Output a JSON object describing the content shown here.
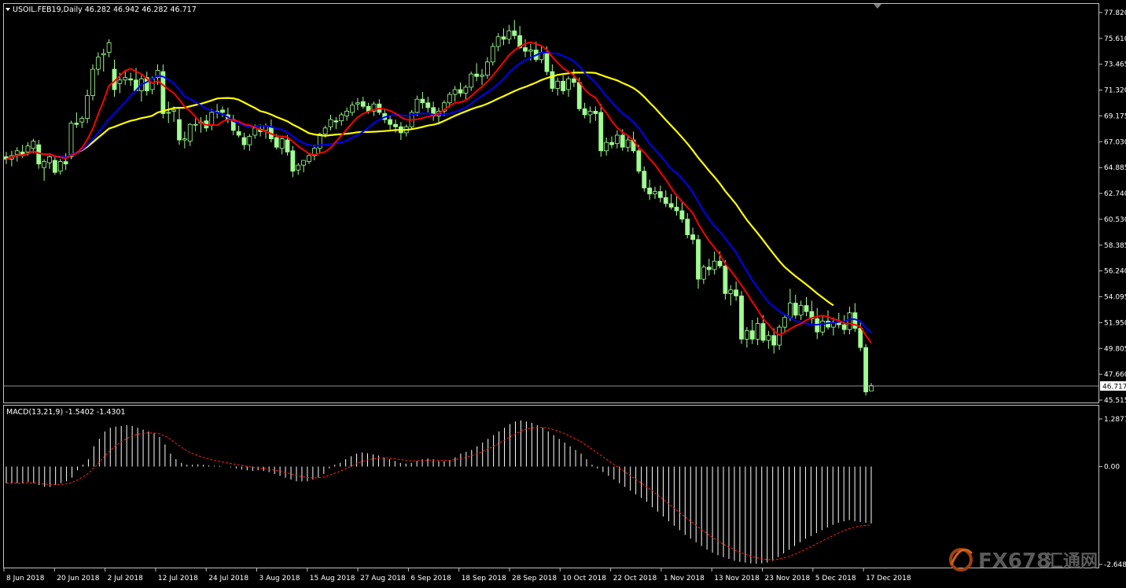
{
  "header": {
    "symbol_line": "USOIL.FEB19,Daily  46.282 46.942 46.282 46.717",
    "macd_line": "MACD(13,21,9) -1.5402 -1.4301",
    "current_price": "46.717"
  },
  "price_axis_labels": [
    "77.820",
    "75.610",
    "73.465",
    "71.320",
    "69.175",
    "67.030",
    "64.885",
    "62.740",
    "60.530",
    "58.385",
    "56.240",
    "54.095",
    "51.950",
    "49.805",
    "47.660",
    "45.515"
  ],
  "macd_axis_labels": [
    "1.2877",
    "0.00",
    "-2.6483"
  ],
  "date_labels": [
    "8 Jun 2018",
    "20 Jun 2018",
    "2 Jul 2018",
    "12 Jul 2018",
    "24 Jul 2018",
    "3 Aug 2018",
    "15 Aug 2018",
    "27 Aug 2018",
    "6 Sep 2018",
    "18 Sep 2018",
    "28 Sep 2018",
    "10 Oct 2018",
    "22 Oct 2018",
    "1 Nov 2018",
    "13 Nov 2018",
    "23 Nov 2018",
    "5 Dec 2018",
    "17 Dec 2018"
  ],
  "watermark": {
    "brand": "FX678",
    "cn": "汇通网"
  },
  "colors": {
    "ma_fast": "#ff0000",
    "ma_mid": "#0000ff",
    "ma_slow": "#ffff00",
    "candle": "#a0ff90",
    "macd_hist": "#ffffff",
    "macd_signal": "#ff2020"
  },
  "chart_data": {
    "type": "candlestick",
    "ylim": [
      45.515,
      77.82
    ],
    "macd_ylim": [
      -2.6483,
      1.2877
    ],
    "candles": [
      [
        65.8,
        66.2,
        65.2,
        65.6
      ],
      [
        65.6,
        66.3,
        65.0,
        65.9
      ],
      [
        66.0,
        66.6,
        65.4,
        66.3
      ],
      [
        66.2,
        66.8,
        65.7,
        65.9
      ],
      [
        66.2,
        67.0,
        65.9,
        66.7
      ],
      [
        66.5,
        67.3,
        66.1,
        67.1
      ],
      [
        66.8,
        67.2,
        64.8,
        65.2
      ],
      [
        64.9,
        65.6,
        63.8,
        65.4
      ],
      [
        65.3,
        66.0,
        64.8,
        65.8
      ],
      [
        65.5,
        65.8,
        64.3,
        64.5
      ],
      [
        64.6,
        65.6,
        64.3,
        65.4
      ],
      [
        65.4,
        66.1,
        64.7,
        65.2
      ],
      [
        65.8,
        68.8,
        65.6,
        68.6
      ],
      [
        68.6,
        69.5,
        68.2,
        68.5
      ],
      [
        68.7,
        69.2,
        68.2,
        69.0
      ],
      [
        69.0,
        71.4,
        68.6,
        70.9
      ],
      [
        70.9,
        73.5,
        70.5,
        73.1
      ],
      [
        73.1,
        74.5,
        72.6,
        74.1
      ],
      [
        74.3,
        74.8,
        72.9,
        74.4
      ],
      [
        74.5,
        75.6,
        74.1,
        75.3
      ],
      [
        73.1,
        73.9,
        70.8,
        71.4
      ],
      [
        71.9,
        72.8,
        71.1,
        72.2
      ],
      [
        72.2,
        72.9,
        71.8,
        72.4
      ],
      [
        72.3,
        72.8,
        71.7,
        72.2
      ],
      [
        72.2,
        73.2,
        71.5,
        71.3
      ],
      [
        71.3,
        72.6,
        70.4,
        72.3
      ],
      [
        72.4,
        72.9,
        70.9,
        71.3
      ],
      [
        71.4,
        72.5,
        71.0,
        72.3
      ],
      [
        72.4,
        73.5,
        71.8,
        73.0
      ],
      [
        72.9,
        73.5,
        69.0,
        69.4
      ],
      [
        69.5,
        70.4,
        68.6,
        69.5
      ],
      [
        69.6,
        70.0,
        68.7,
        69.7
      ],
      [
        68.9,
        69.8,
        66.8,
        67.2
      ],
      [
        67.2,
        67.9,
        66.5,
        67.3
      ],
      [
        67.1,
        68.6,
        66.7,
        68.5
      ],
      [
        68.5,
        69.0,
        67.9,
        68.5
      ],
      [
        68.6,
        69.1,
        67.8,
        68.7
      ],
      [
        68.8,
        69.3,
        67.9,
        68.2
      ],
      [
        68.4,
        69.8,
        68.0,
        69.5
      ],
      [
        69.5,
        70.2,
        69.0,
        69.6
      ],
      [
        69.7,
        70.0,
        69.1,
        69.5
      ],
      [
        69.3,
        69.9,
        68.6,
        68.9
      ],
      [
        68.9,
        69.3,
        67.6,
        68.0
      ],
      [
        67.9,
        68.4,
        67.4,
        67.6
      ],
      [
        67.4,
        67.8,
        66.4,
        66.8
      ],
      [
        66.8,
        67.7,
        66.3,
        67.5
      ],
      [
        67.6,
        68.5,
        67.3,
        68.2
      ],
      [
        68.1,
        68.5,
        67.5,
        67.9
      ],
      [
        68.0,
        68.6,
        67.3,
        68.4
      ],
      [
        68.3,
        68.9,
        67.0,
        67.3
      ],
      [
        67.4,
        67.7,
        66.4,
        66.6
      ],
      [
        66.5,
        67.5,
        66.0,
        67.3
      ],
      [
        67.2,
        67.6,
        65.9,
        66.2
      ],
      [
        66.3,
        66.7,
        64.1,
        64.6
      ],
      [
        64.7,
        65.3,
        64.3,
        65.1
      ],
      [
        65.1,
        65.5,
        64.5,
        65.5
      ],
      [
        65.4,
        66.1,
        65.2,
        65.9
      ],
      [
        65.9,
        66.8,
        65.5,
        66.5
      ],
      [
        66.5,
        67.8,
        66.1,
        67.7
      ],
      [
        67.7,
        68.4,
        67.4,
        68.2
      ],
      [
        68.3,
        69.3,
        68.0,
        68.9
      ],
      [
        68.8,
        69.1,
        68.1,
        68.7
      ],
      [
        68.8,
        69.5,
        68.4,
        69.3
      ],
      [
        69.2,
        69.9,
        68.8,
        69.6
      ],
      [
        69.5,
        70.4,
        69.2,
        70.1
      ],
      [
        70.2,
        70.7,
        69.7,
        70.3
      ],
      [
        70.4,
        70.8,
        69.8,
        70.0
      ],
      [
        70.0,
        70.3,
        69.4,
        69.6
      ],
      [
        69.6,
        70.4,
        69.2,
        70.2
      ],
      [
        70.2,
        70.6,
        69.3,
        69.5
      ],
      [
        69.4,
        69.8,
        68.6,
        68.9
      ],
      [
        68.9,
        69.3,
        68.0,
        68.5
      ],
      [
        68.5,
        68.9,
        67.8,
        68.3
      ],
      [
        68.3,
        68.7,
        67.2,
        67.8
      ],
      [
        67.8,
        68.5,
        67.5,
        68.3
      ],
      [
        68.3,
        69.7,
        68.1,
        69.5
      ],
      [
        69.5,
        70.9,
        69.2,
        70.6
      ],
      [
        70.6,
        71.2,
        69.8,
        70.3
      ],
      [
        70.3,
        70.8,
        69.5,
        69.9
      ],
      [
        69.9,
        70.4,
        68.8,
        69.2
      ],
      [
        69.2,
        69.9,
        68.5,
        69.6
      ],
      [
        69.6,
        70.5,
        69.2,
        70.3
      ],
      [
        70.3,
        71.2,
        69.9,
        71.0
      ],
      [
        71.0,
        71.7,
        70.4,
        71.4
      ],
      [
        71.4,
        72.0,
        70.8,
        71.1
      ],
      [
        71.1,
        71.8,
        70.6,
        71.6
      ],
      [
        71.6,
        72.9,
        71.3,
        72.7
      ],
      [
        72.7,
        73.6,
        72.1,
        72.5
      ],
      [
        72.5,
        73.1,
        71.8,
        72.6
      ],
      [
        72.6,
        74.1,
        72.3,
        73.7
      ],
      [
        73.7,
        75.3,
        73.4,
        75.0
      ],
      [
        75.0,
        76.1,
        74.6,
        75.8
      ],
      [
        75.8,
        76.5,
        75.1,
        75.6
      ],
      [
        75.6,
        76.8,
        75.2,
        76.3
      ],
      [
        76.3,
        77.2,
        75.6,
        75.9
      ],
      [
        75.9,
        76.7,
        74.8,
        74.9
      ],
      [
        74.9,
        75.6,
        74.1,
        74.6
      ],
      [
        74.6,
        75.2,
        73.8,
        74.7
      ],
      [
        74.7,
        75.4,
        73.7,
        73.9
      ],
      [
        73.9,
        75.0,
        73.6,
        74.5
      ],
      [
        74.5,
        75.0,
        72.6,
        72.9
      ],
      [
        72.9,
        73.5,
        71.2,
        71.5
      ],
      [
        71.5,
        72.4,
        70.9,
        72.1
      ],
      [
        72.1,
        72.6,
        71.0,
        71.3
      ],
      [
        71.4,
        72.5,
        70.8,
        72.3
      ],
      [
        72.3,
        73.1,
        71.6,
        72.0
      ],
      [
        72.0,
        72.4,
        69.6,
        69.8
      ],
      [
        69.8,
        70.3,
        69.0,
        69.3
      ],
      [
        69.3,
        70.0,
        68.6,
        69.6
      ],
      [
        69.6,
        70.0,
        68.8,
        69.4
      ],
      [
        69.5,
        70.2,
        65.8,
        66.3
      ],
      [
        66.3,
        67.4,
        65.9,
        67.0
      ],
      [
        67.0,
        67.5,
        66.5,
        66.8
      ],
      [
        66.9,
        68.0,
        66.5,
        67.6
      ],
      [
        67.6,
        68.1,
        66.3,
        66.6
      ],
      [
        66.6,
        67.6,
        66.2,
        67.2
      ],
      [
        67.2,
        67.9,
        66.1,
        66.3
      ],
      [
        66.3,
        66.8,
        64.4,
        64.6
      ],
      [
        64.6,
        65.0,
        62.9,
        63.2
      ],
      [
        63.2,
        63.9,
        62.2,
        62.7
      ],
      [
        62.7,
        63.3,
        62.3,
        62.9
      ],
      [
        62.9,
        63.4,
        62.0,
        62.4
      ],
      [
        62.4,
        63.0,
        61.6,
        61.9
      ],
      [
        61.9,
        62.7,
        61.4,
        61.6
      ],
      [
        61.6,
        62.5,
        60.9,
        61.3
      ],
      [
        61.3,
        62.0,
        60.3,
        60.6
      ],
      [
        60.6,
        61.1,
        59.0,
        59.3
      ],
      [
        59.3,
        59.9,
        58.5,
        58.9
      ],
      [
        58.9,
        59.3,
        54.8,
        55.6
      ],
      [
        55.6,
        56.8,
        55.2,
        56.6
      ],
      [
        56.6,
        57.3,
        55.9,
        56.4
      ],
      [
        56.4,
        57.9,
        56.0,
        57.1
      ],
      [
        57.1,
        57.9,
        56.5,
        56.7
      ],
      [
        56.7,
        57.2,
        53.9,
        54.4
      ],
      [
        54.4,
        55.1,
        53.4,
        54.7
      ],
      [
        54.7,
        55.4,
        53.8,
        54.2
      ],
      [
        54.2,
        54.6,
        50.2,
        50.6
      ],
      [
        50.6,
        51.6,
        49.9,
        51.3
      ],
      [
        51.3,
        52.2,
        50.2,
        50.6
      ],
      [
        50.6,
        52.4,
        50.1,
        51.9
      ],
      [
        51.9,
        52.6,
        50.3,
        50.5
      ],
      [
        50.5,
        51.3,
        49.8,
        50.9
      ],
      [
        50.9,
        51.5,
        49.4,
        50.1
      ],
      [
        50.1,
        51.8,
        49.7,
        51.6
      ],
      [
        51.6,
        52.7,
        51.1,
        52.4
      ],
      [
        52.4,
        54.8,
        52.1,
        53.6
      ],
      [
        53.6,
        54.3,
        52.3,
        52.6
      ],
      [
        52.6,
        53.8,
        52.2,
        53.4
      ],
      [
        53.4,
        54.1,
        52.5,
        52.9
      ],
      [
        52.9,
        53.8,
        51.9,
        52.3
      ],
      [
        52.3,
        53.2,
        50.6,
        51.2
      ],
      [
        51.2,
        52.5,
        50.9,
        52.1
      ],
      [
        52.1,
        53.0,
        51.4,
        51.6
      ],
      [
        51.6,
        52.4,
        50.9,
        52.0
      ],
      [
        52.0,
        52.8,
        51.5,
        51.8
      ],
      [
        51.8,
        52.6,
        51.0,
        51.4
      ],
      [
        51.4,
        53.3,
        51.0,
        52.8
      ],
      [
        52.8,
        53.6,
        51.2,
        51.5
      ],
      [
        51.5,
        52.0,
        49.6,
        49.9
      ],
      [
        49.9,
        50.2,
        45.9,
        46.2
      ],
      [
        46.282,
        46.942,
        46.282,
        46.717
      ]
    ],
    "macd_hist": [
      -0.45,
      -0.45,
      -0.45,
      -0.45,
      -0.42,
      -0.45,
      -0.5,
      -0.55,
      -0.55,
      -0.5,
      -0.45,
      -0.4,
      -0.3,
      -0.1,
      0.05,
      0.2,
      0.55,
      0.75,
      0.95,
      1.05,
      1.08,
      1.1,
      1.12,
      1.1,
      1.05,
      1.0,
      0.95,
      0.9,
      0.8,
      0.6,
      0.35,
      0.2,
      0.1,
      0.05,
      0.05,
      0.06,
      0.05,
      0.03,
      0.02,
      0.02,
      0.0,
      -0.02,
      -0.05,
      -0.08,
      -0.1,
      -0.12,
      -0.1,
      -0.12,
      -0.15,
      -0.2,
      -0.25,
      -0.3,
      -0.35,
      -0.4,
      -0.4,
      -0.4,
      -0.35,
      -0.3,
      -0.2,
      -0.05,
      0.05,
      0.1,
      0.2,
      0.28,
      0.35,
      0.38,
      0.36,
      0.33,
      0.3,
      0.25,
      0.2,
      0.15,
      0.1,
      0.08,
      0.1,
      0.15,
      0.2,
      0.22,
      0.2,
      0.15,
      0.15,
      0.18,
      0.25,
      0.35,
      0.4,
      0.45,
      0.55,
      0.65,
      0.75,
      0.85,
      0.95,
      1.05,
      1.15,
      1.22,
      1.25,
      1.22,
      1.18,
      1.12,
      1.05,
      0.95,
      0.85,
      0.75,
      0.65,
      0.55,
      0.45,
      0.35,
      0.2,
      0.05,
      -0.05,
      -0.15,
      -0.25,
      -0.35,
      -0.45,
      -0.55,
      -0.65,
      -0.75,
      -0.85,
      -0.95,
      -1.1,
      -1.22,
      -1.35,
      -1.48,
      -1.6,
      -1.72,
      -1.85,
      -1.95,
      -2.05,
      -2.15,
      -2.25,
      -2.33,
      -2.4,
      -2.45,
      -2.5,
      -2.55,
      -2.58,
      -2.6,
      -2.62,
      -2.63,
      -2.62,
      -2.6,
      -2.55,
      -2.45,
      -2.35,
      -2.25,
      -2.15,
      -2.05,
      -1.95,
      -1.88,
      -1.8,
      -1.72,
      -1.65,
      -1.58,
      -1.52,
      -1.48,
      -1.45,
      -1.48,
      -1.5,
      -1.52,
      -1.54
    ]
  }
}
